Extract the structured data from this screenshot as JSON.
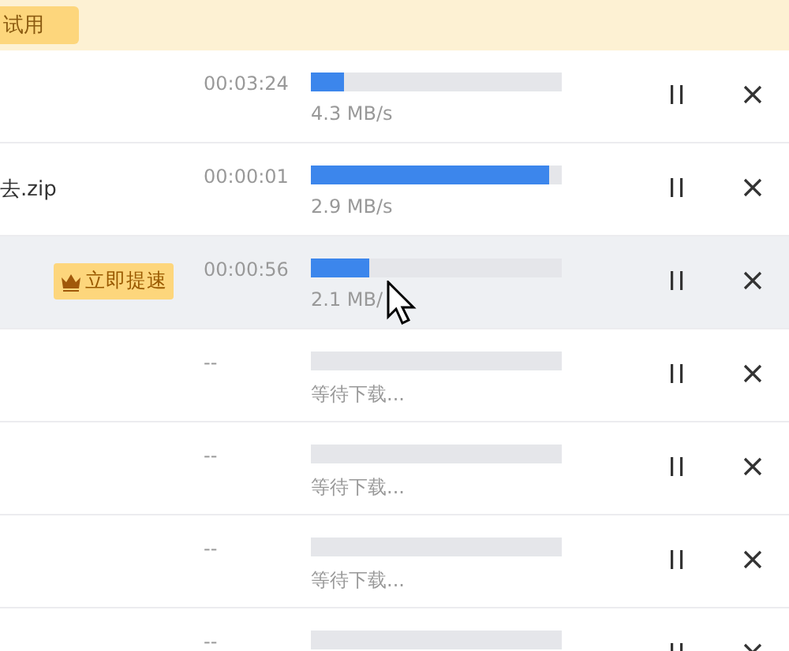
{
  "banner": {
    "trial_button": "试用"
  },
  "downloads": [
    {
      "time": "00:03:24",
      "level": 0.13,
      "status": "4.3 MB/s",
      "highlighted": false
    },
    {
      "name": "去.zip",
      "time": "00:00:01",
      "level": 0.95,
      "status": "2.9 MB/s",
      "highlighted": false
    },
    {
      "boost_button": "立即提速",
      "time": "00:00:56",
      "level": 0.23,
      "status": "2.1 MB/",
      "highlighted": true
    },
    {
      "time": "--",
      "status": "等待下载...",
      "highlighted": false
    },
    {
      "time": "--",
      "status": "等待下载...",
      "highlighted": false
    },
    {
      "time": "--",
      "status": "等待下载...",
      "highlighted": false
    },
    {
      "time": "--",
      "highlighted": false
    }
  ]
}
